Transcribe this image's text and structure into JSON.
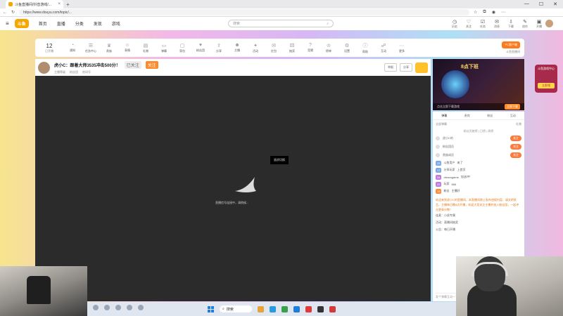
{
  "browser": {
    "tab_title": "斗鱼直播间/抖音游戏/...",
    "url": "https://www.douyu.com/topic/...",
    "window_controls": [
      "—",
      "☐",
      "✕"
    ]
  },
  "site": {
    "logo_text": "斗鱼",
    "nav": [
      "首页",
      "直播",
      "分类",
      "发现",
      "游戏"
    ],
    "search_placeholder": "搜索",
    "header_icons": [
      {
        "name": "history",
        "label": "历史"
      },
      {
        "name": "follow",
        "label": "关注"
      },
      {
        "name": "task",
        "label": "任务"
      },
      {
        "name": "message",
        "label": "消息"
      },
      {
        "name": "download",
        "label": "下载"
      },
      {
        "name": "creator",
        "label": "创作"
      },
      {
        "name": "live",
        "label": "开播"
      }
    ]
  },
  "roombar": {
    "level": "12",
    "level_sub": "已开播",
    "items": [
      "通知",
      "任务中心",
      "贵族",
      "表情",
      "礼物",
      "弹幕",
      "背包",
      "粉丝团",
      "分享",
      "主播",
      "活动",
      "红包",
      "抽奖",
      "竞猜",
      "榜单",
      "设置",
      "帮助",
      "互动",
      "更多"
    ],
    "pc_button": "PC客户端",
    "right_note": "斗鱼直播间"
  },
  "player": {
    "anchor_title": "虎小C：跟着大师3535冲击500分！",
    "tag1": "已关注",
    "tag2": "关注",
    "sub_info": [
      "主播等级",
      "粉丝团",
      "房间号"
    ],
    "btn_report": "举报",
    "btn_share": "分享",
    "video_tag": "画质切换",
    "video_loading": "直播信号连接中，请稍候..."
  },
  "promo": {
    "headline": "8点下班",
    "bottom_text": "点击立即下载游戏",
    "button": "立即下载"
  },
  "chat": {
    "tabs": [
      "弹幕",
      "贵宾",
      "粉丝",
      "互动"
    ],
    "subbar_left": "全部弹幕",
    "subbar_right": "礼物",
    "subbar2": "粉丝贡献榜 | 日榜 | 周榜",
    "ranks": [
      {
        "name": "虎小C的",
        "pill": "关注"
      },
      {
        "name": "粉丝团员",
        "pill": "关注"
      },
      {
        "name": "贵族成员",
        "pill": "关注"
      }
    ],
    "messages": [
      {
        "lv": "25",
        "cls": "b",
        "name": "斗鱼用户",
        "text": "来了"
      },
      {
        "lv": "17",
        "cls": "b",
        "name": "分享玩家",
        "text": "上首页"
      },
      {
        "lv": "34",
        "cls": "p",
        "name": "dreamgame",
        "text": "加油冲！"
      },
      {
        "lv": "22",
        "cls": "p",
        "name": "玩家",
        "text": "666"
      },
      {
        "lv": "19",
        "cls": "o",
        "name": "粉丝",
        "text": "主播好"
      }
    ],
    "announce": "欢迎来到虎小C的直播间，本直播间禁止发布违规内容，请文明发言。主播每日晚8点开播，欢迎大家关注主播并加入粉丝团，一起冲击更高分数！",
    "footer_lines": [
      "连麦：小虎专属",
      "活动：直播间抽奖",
      "公告：每日开播"
    ],
    "input_placeholder": "发个弹幕互动一下吧"
  },
  "side_ad": {
    "label": "斗鱼游戏中心",
    "button": "立即领"
  },
  "taskbar": {
    "search": "搜索"
  }
}
